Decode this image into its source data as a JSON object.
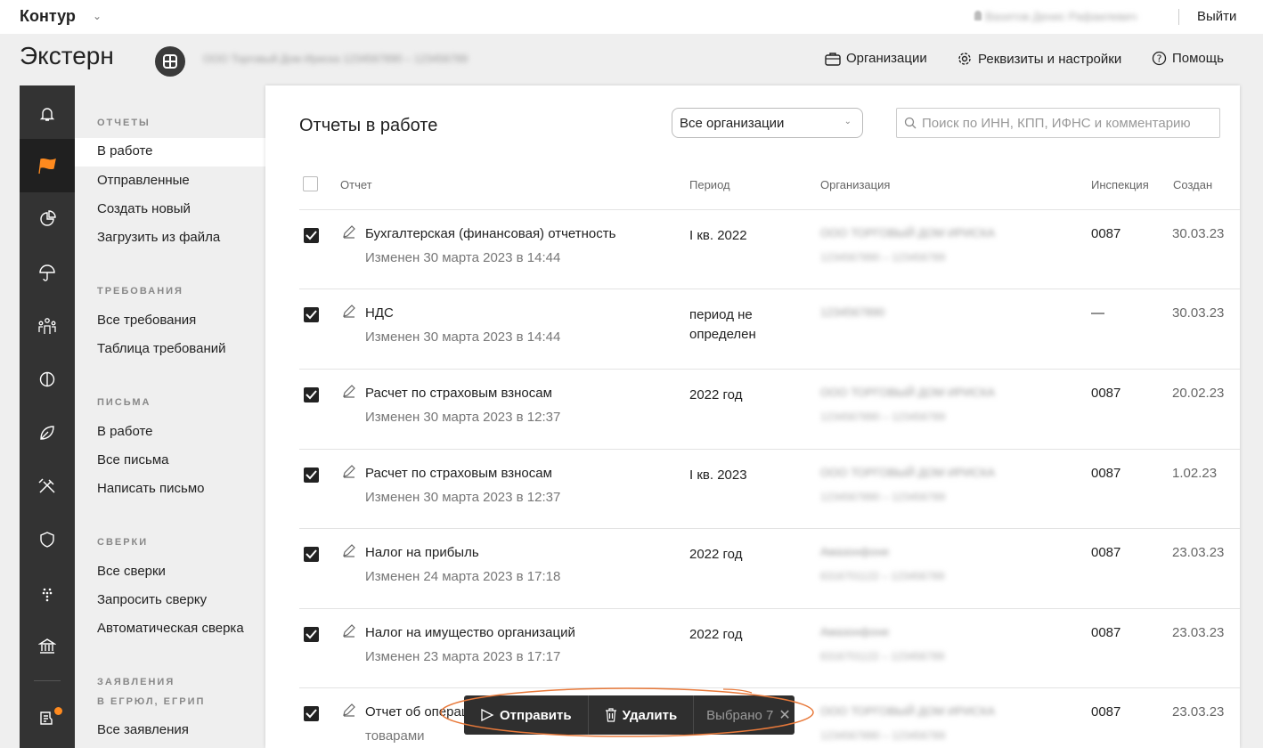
{
  "topbar": {
    "brand": "Контур",
    "user_name": "Вахитов Денис Рафаилевич",
    "logout": "Выйти"
  },
  "header": {
    "product": "Экстерн",
    "org_name": "ООО Торговый Дом Ириска  1234567890 – 123456789",
    "links": {
      "organizations": "Организации",
      "settings": "Реквизиты и настройки",
      "help": "Помощь"
    }
  },
  "rail": {
    "items": [
      "bell-icon",
      "flag-icon",
      "pie-chart-icon",
      "umbrella-icon",
      "people-icon",
      "ruble-icon",
      "leaf-icon",
      "tools-icon",
      "shield-icon",
      "grapes-icon",
      "bank-icon",
      "document-icon"
    ]
  },
  "subnav": {
    "reports_title": "ОТЧЕТЫ",
    "reports": [
      "В работе",
      "Отправленные",
      "Создать новый",
      "Загрузить из файла"
    ],
    "demands_title": "ТРЕБОВАНИЯ",
    "demands": [
      "Все требования",
      "Таблица требований"
    ],
    "letters_title": "ПИСЬМА",
    "letters": [
      "В работе",
      "Все письма",
      "Написать письмо"
    ],
    "reconciliations_title": "СВЕРКИ",
    "reconciliations": [
      "Все сверки",
      "Запросить сверку",
      "Автоматическая сверка"
    ],
    "applications_title_1": "ЗАЯВЛЕНИЯ",
    "applications_title_2": "В ЕГРЮЛ, ЕГРИП",
    "applications": [
      "Все заявления"
    ]
  },
  "main": {
    "title": "Отчеты в работе",
    "org_filter": "Все организации",
    "search_placeholder": "Поиск по ИНН, КПП, ИФНС и комментарию",
    "columns": {
      "report": "Отчет",
      "period": "Период",
      "organization": "Организация",
      "inspection": "Инспекция",
      "created": "Создан"
    },
    "rows": [
      {
        "name": "Бухгалтерская (финансовая) отчетность",
        "modified": "Изменен 30 марта 2023 в 14:44",
        "period": "I кв. 2022",
        "org": "ООО ТОРГОВЫЙ ДОМ ИРИСКА",
        "org_ids": "1234567890 – 123456789",
        "inspection": "0087",
        "created": "30.03.23",
        "checked": true
      },
      {
        "name": "НДС",
        "modified": "Изменен 30 марта 2023 в 14:44",
        "period": "период не определен",
        "org": "1234567890",
        "org_ids": "",
        "inspection": "—",
        "created": "30.03.23",
        "checked": true
      },
      {
        "name": "Расчет по страховым взносам",
        "modified": "Изменен 30 марта 2023 в 12:37",
        "period": "2022 год",
        "org": "ООО ТОРГОВЫЙ ДОМ ИРИСКА",
        "org_ids": "1234567890 – 123456789",
        "inspection": "0087",
        "created": "20.02.23",
        "checked": true
      },
      {
        "name": "Расчет по страховым взносам",
        "modified": "Изменен 30 марта 2023 в 12:37",
        "period": "I кв. 2023",
        "org": "ООО ТОРГОВЫЙ ДОМ ИРИСКА",
        "org_ids": "1234567890 – 123456789",
        "inspection": "0087",
        "created": "1.02.23",
        "checked": true
      },
      {
        "name": "Налог на прибыль",
        "modified": "Изменен 24 марта 2023 в 17:18",
        "period": "2022 год",
        "org": "Амазонфоне",
        "org_ids": "6316701122 – 123456789",
        "inspection": "0087",
        "created": "23.03.23",
        "checked": true
      },
      {
        "name": "Налог на имущество организаций",
        "modified": "Изменен 23 марта 2023 в 17:17",
        "period": "2022 год",
        "org": "Амазонфоне",
        "org_ids": "6316701122 – 123456789",
        "inspection": "0087",
        "created": "23.03.23",
        "checked": true
      },
      {
        "name": "Отчет об операц",
        "modified": "товарами",
        "period": "",
        "org": "ООО ТОРГОВЫЙ ДОМ ИРИСКА",
        "org_ids": "1234567890 – 123456789",
        "inspection": "0087",
        "created": "23.03.23",
        "checked": true
      }
    ]
  },
  "actionbar": {
    "send": "Отправить",
    "delete": "Удалить",
    "selected": "Выбрано 7"
  },
  "colors": {
    "rail_bg": "#333333",
    "rail_active": "#202020",
    "accent_orange": "#ff8a1e",
    "highlight_ellipse": "#e8793a"
  }
}
